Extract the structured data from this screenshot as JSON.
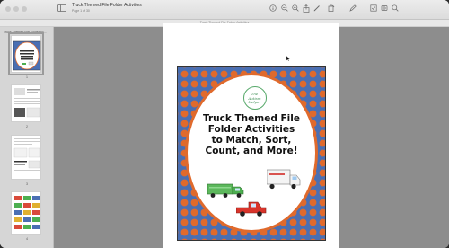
{
  "window": {
    "title": "Truck Themed File Folder Activities",
    "subtitle": "Page 1 of 30",
    "path_caption": "Truck Themed File Folder Activities"
  },
  "sidebar": {
    "title": "Truck Themed File Folder Ac...",
    "thumbnails": [
      {
        "number": "1",
        "selected": true
      },
      {
        "number": "2",
        "selected": false
      },
      {
        "number": "3",
        "selected": false
      },
      {
        "number": "4",
        "selected": false
      }
    ]
  },
  "toolbar": {
    "icons": [
      "sidebar-icon",
      "info-icon",
      "zoom-out-icon",
      "zoom-in-icon",
      "share-icon",
      "markup-icon",
      "rotate-icon",
      "annotate-icon",
      "form-icon",
      "highlight-icon",
      "search-icon"
    ]
  },
  "page": {
    "logo_line1": "The Autism",
    "logo_line2": "Helper",
    "title_lines": [
      "Truck Themed File",
      "Folder Activities",
      "to Match, Sort,",
      "Count, and More!"
    ]
  },
  "colors": {
    "cover_blue": "#4a6fb3",
    "cover_orange": "#e06a2c",
    "logo_green": "#3e8f55"
  }
}
